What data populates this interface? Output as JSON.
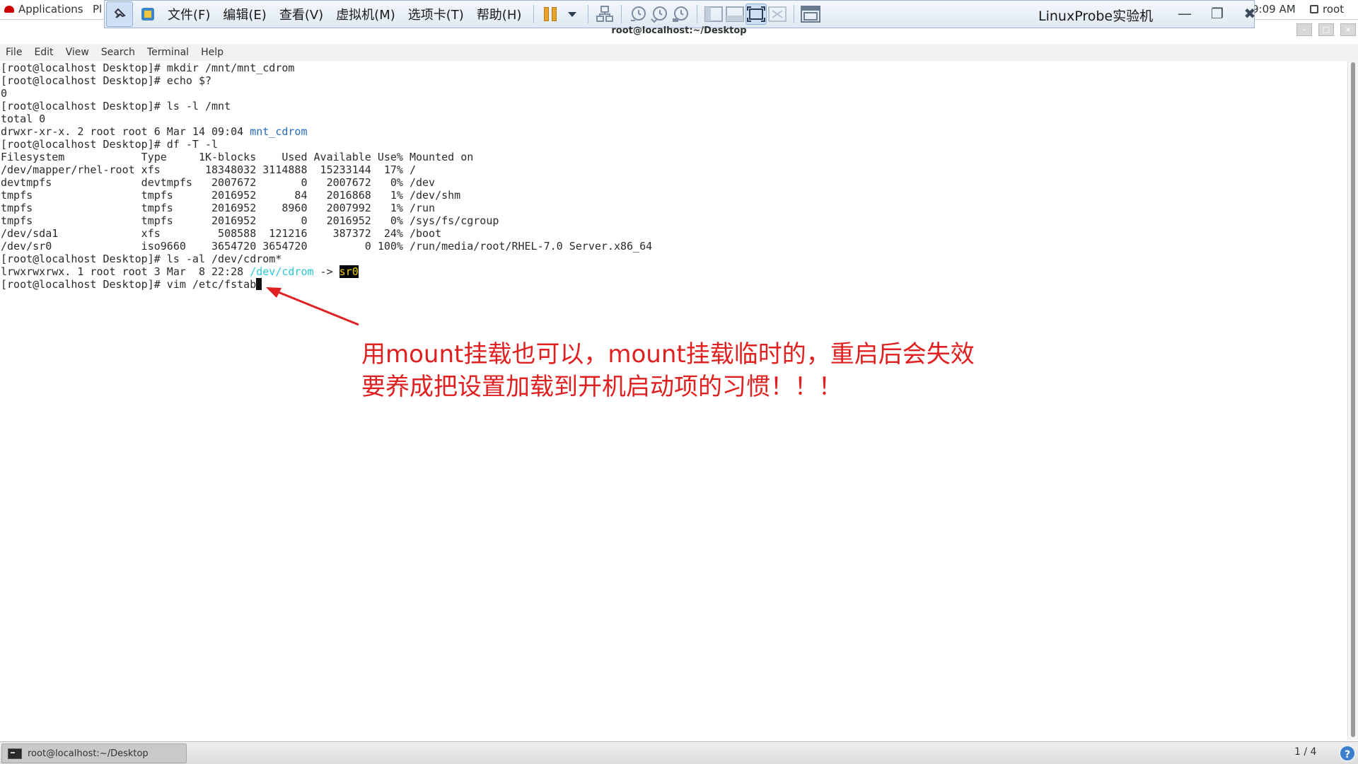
{
  "topbar": {
    "applications_label": "Applications",
    "places_partial": "Pl",
    "clock_partial": "9:09 AM",
    "user_label": "root"
  },
  "vm_toolbar": {
    "menus": [
      "文件(F)",
      "编辑(E)",
      "查看(V)",
      "虚拟机(M)",
      "选项卡(T)",
      "帮助(H)"
    ],
    "title": "LinuxProbe实验机",
    "accent_color": "#e8a32b"
  },
  "terminal": {
    "window_title": "root@localhost:~/Desktop",
    "menu": [
      "File",
      "Edit",
      "View",
      "Search",
      "Terminal",
      "Help"
    ],
    "lines": [
      {
        "text": "[root@localhost Desktop]# mkdir /mnt/mnt_cdrom"
      },
      {
        "text": "[root@localhost Desktop]# echo $?"
      },
      {
        "text": "0"
      },
      {
        "text": "[root@localhost Desktop]# ls -l /mnt"
      },
      {
        "text": "total 0"
      },
      {
        "prefix": "drwxr-xr-x. 2 root root 6 Mar 14 09:04 ",
        "dir": "mnt_cdrom"
      },
      {
        "text": "[root@localhost Desktop]# df -T -l"
      },
      {
        "text": "Filesystem            Type     1K-blocks    Used Available Use% Mounted on"
      },
      {
        "text": "/dev/mapper/rhel-root xfs       18348032 3114888  15233144  17% /"
      },
      {
        "text": "devtmpfs              devtmpfs   2007672       0   2007672   0% /dev"
      },
      {
        "text": "tmpfs                 tmpfs      2016952      84   2016868   1% /dev/shm"
      },
      {
        "text": "tmpfs                 tmpfs      2016952    8960   2007992   1% /run"
      },
      {
        "text": "tmpfs                 tmpfs      2016952       0   2016952   0% /sys/fs/cgroup"
      },
      {
        "text": "/dev/sda1             xfs         508588  121216    387372  24% /boot"
      },
      {
        "text": "/dev/sr0              iso9660    3654720 3654720         0 100% /run/media/root/RHEL-7.0 Server.x86_64"
      },
      {
        "text": "[root@localhost Desktop]# ls -al /dev/cdrom*"
      },
      {
        "prefix": "lrwxrwxrwx. 1 root root 3 Mar  8 22:28 ",
        "link": "/dev/cdrom",
        "arrow": " -> ",
        "target": "sr0"
      },
      {
        "text": "[root@localhost Desktop]# vim /etc/fstab",
        "cursor": true
      }
    ],
    "colors": {
      "directory": "#2a6cb6",
      "symlink": "#2cc7d6",
      "highlight_bg": "#000000",
      "highlight_fg": "#f2d300"
    }
  },
  "annotation": {
    "line1": "用mount挂载也可以，mount挂载临时的，重启后会失效",
    "line2": "要养成把设置加载到开机启动项的习惯！！！",
    "color": "#e02020"
  },
  "taskbar": {
    "task_label": "root@localhost:~/Desktop",
    "workspace": "1 / 4"
  }
}
